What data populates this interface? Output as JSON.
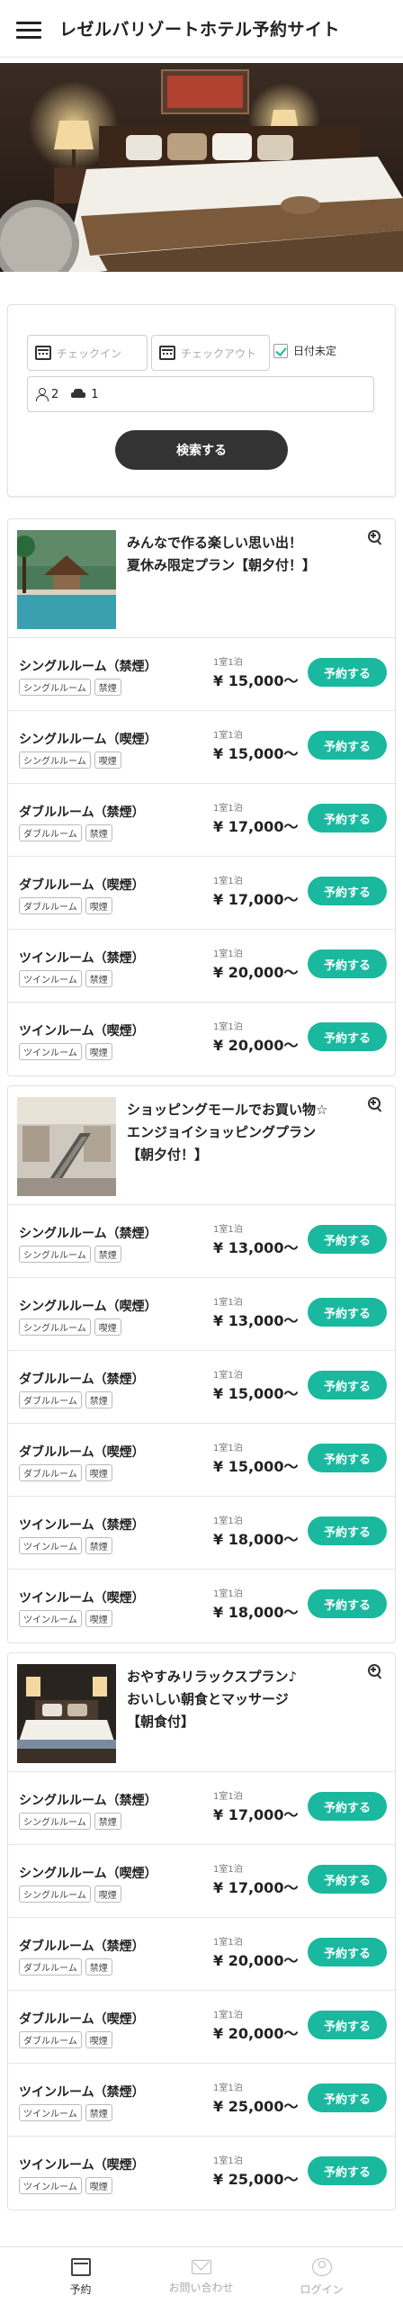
{
  "header": {
    "title": "レゼルバリゾートホテル予約サイト"
  },
  "search": {
    "checkin_placeholder": "チェックイン",
    "checkout_placeholder": "チェックアウト",
    "undecided_label": "日付未定",
    "guests": "2",
    "rooms": "1",
    "search_label": "検索する"
  },
  "plans": [
    {
      "title_line1": "みんなで作る楽しい思い出！",
      "title_line2": "夏休み限定プラン【朝夕付！】",
      "title_line3": "",
      "rooms": [
        {
          "name": "シングルルーム（禁煙）",
          "tag1": "シングルルーム",
          "tag2": "禁煙",
          "per": "1室1泊",
          "price": "¥ 15,000〜",
          "button": "予約する"
        },
        {
          "name": "シングルルーム（喫煙）",
          "tag1": "シングルルーム",
          "tag2": "喫煙",
          "per": "1室1泊",
          "price": "¥ 15,000〜",
          "button": "予約する"
        },
        {
          "name": "ダブルルーム（禁煙）",
          "tag1": "ダブルルーム",
          "tag2": "禁煙",
          "per": "1室1泊",
          "price": "¥ 17,000〜",
          "button": "予約する"
        },
        {
          "name": "ダブルルーム（喫煙）",
          "tag1": "ダブルルーム",
          "tag2": "喫煙",
          "per": "1室1泊",
          "price": "¥ 17,000〜",
          "button": "予約する"
        },
        {
          "name": "ツインルーム（禁煙）",
          "tag1": "ツインルーム",
          "tag2": "禁煙",
          "per": "1室1泊",
          "price": "¥ 20,000〜",
          "button": "予約する"
        },
        {
          "name": "ツインルーム（喫煙）",
          "tag1": "ツインルーム",
          "tag2": "喫煙",
          "per": "1室1泊",
          "price": "¥ 20,000〜",
          "button": "予約する"
        }
      ]
    },
    {
      "title_line1": "ショッピングモールでお買い物☆",
      "title_line2": "エンジョイショッピングプラン",
      "title_line3": "【朝夕付！】",
      "rooms": [
        {
          "name": "シングルルーム（禁煙）",
          "tag1": "シングルルーム",
          "tag2": "禁煙",
          "per": "1室1泊",
          "price": "¥ 13,000〜",
          "button": "予約する"
        },
        {
          "name": "シングルルーム（喫煙）",
          "tag1": "シングルルーム",
          "tag2": "喫煙",
          "per": "1室1泊",
          "price": "¥ 13,000〜",
          "button": "予約する"
        },
        {
          "name": "ダブルルーム（禁煙）",
          "tag1": "ダブルルーム",
          "tag2": "禁煙",
          "per": "1室1泊",
          "price": "¥ 15,000〜",
          "button": "予約する"
        },
        {
          "name": "ダブルルーム（喫煙）",
          "tag1": "ダブルルーム",
          "tag2": "喫煙",
          "per": "1室1泊",
          "price": "¥ 15,000〜",
          "button": "予約する"
        },
        {
          "name": "ツインルーム（禁煙）",
          "tag1": "ツインルーム",
          "tag2": "禁煙",
          "per": "1室1泊",
          "price": "¥ 18,000〜",
          "button": "予約する"
        },
        {
          "name": "ツインルーム（喫煙）",
          "tag1": "ツインルーム",
          "tag2": "喫煙",
          "per": "1室1泊",
          "price": "¥ 18,000〜",
          "button": "予約する"
        }
      ]
    },
    {
      "title_line1": "おやすみリラックスプラン♪",
      "title_line2": "おいしい朝食とマッサージ",
      "title_line3": "【朝食付】",
      "rooms": [
        {
          "name": "シングルルーム（禁煙）",
          "tag1": "シングルルーム",
          "tag2": "禁煙",
          "per": "1室1泊",
          "price": "¥ 17,000〜",
          "button": "予約する"
        },
        {
          "name": "シングルルーム（喫煙）",
          "tag1": "シングルルーム",
          "tag2": "喫煙",
          "per": "1室1泊",
          "price": "¥ 17,000〜",
          "button": "予約する"
        },
        {
          "name": "ダブルルーム（禁煙）",
          "tag1": "ダブルルーム",
          "tag2": "禁煙",
          "per": "1室1泊",
          "price": "¥ 20,000〜",
          "button": "予約する"
        },
        {
          "name": "ダブルルーム（喫煙）",
          "tag1": "ダブルルーム",
          "tag2": "喫煙",
          "per": "1室1泊",
          "price": "¥ 20,000〜",
          "button": "予約する"
        },
        {
          "name": "ツインルーム（禁煙）",
          "tag1": "ツインルーム",
          "tag2": "禁煙",
          "per": "1室1泊",
          "price": "¥ 25,000〜",
          "button": "予約する"
        },
        {
          "name": "ツインルーム（喫煙）",
          "tag1": "ツインルーム",
          "tag2": "喫煙",
          "per": "1室1泊",
          "price": "¥ 25,000〜",
          "button": "予約する"
        }
      ]
    }
  ],
  "bottom_nav": {
    "reserve": "予約",
    "contact": "お問い合わせ",
    "login": "ログイン"
  }
}
